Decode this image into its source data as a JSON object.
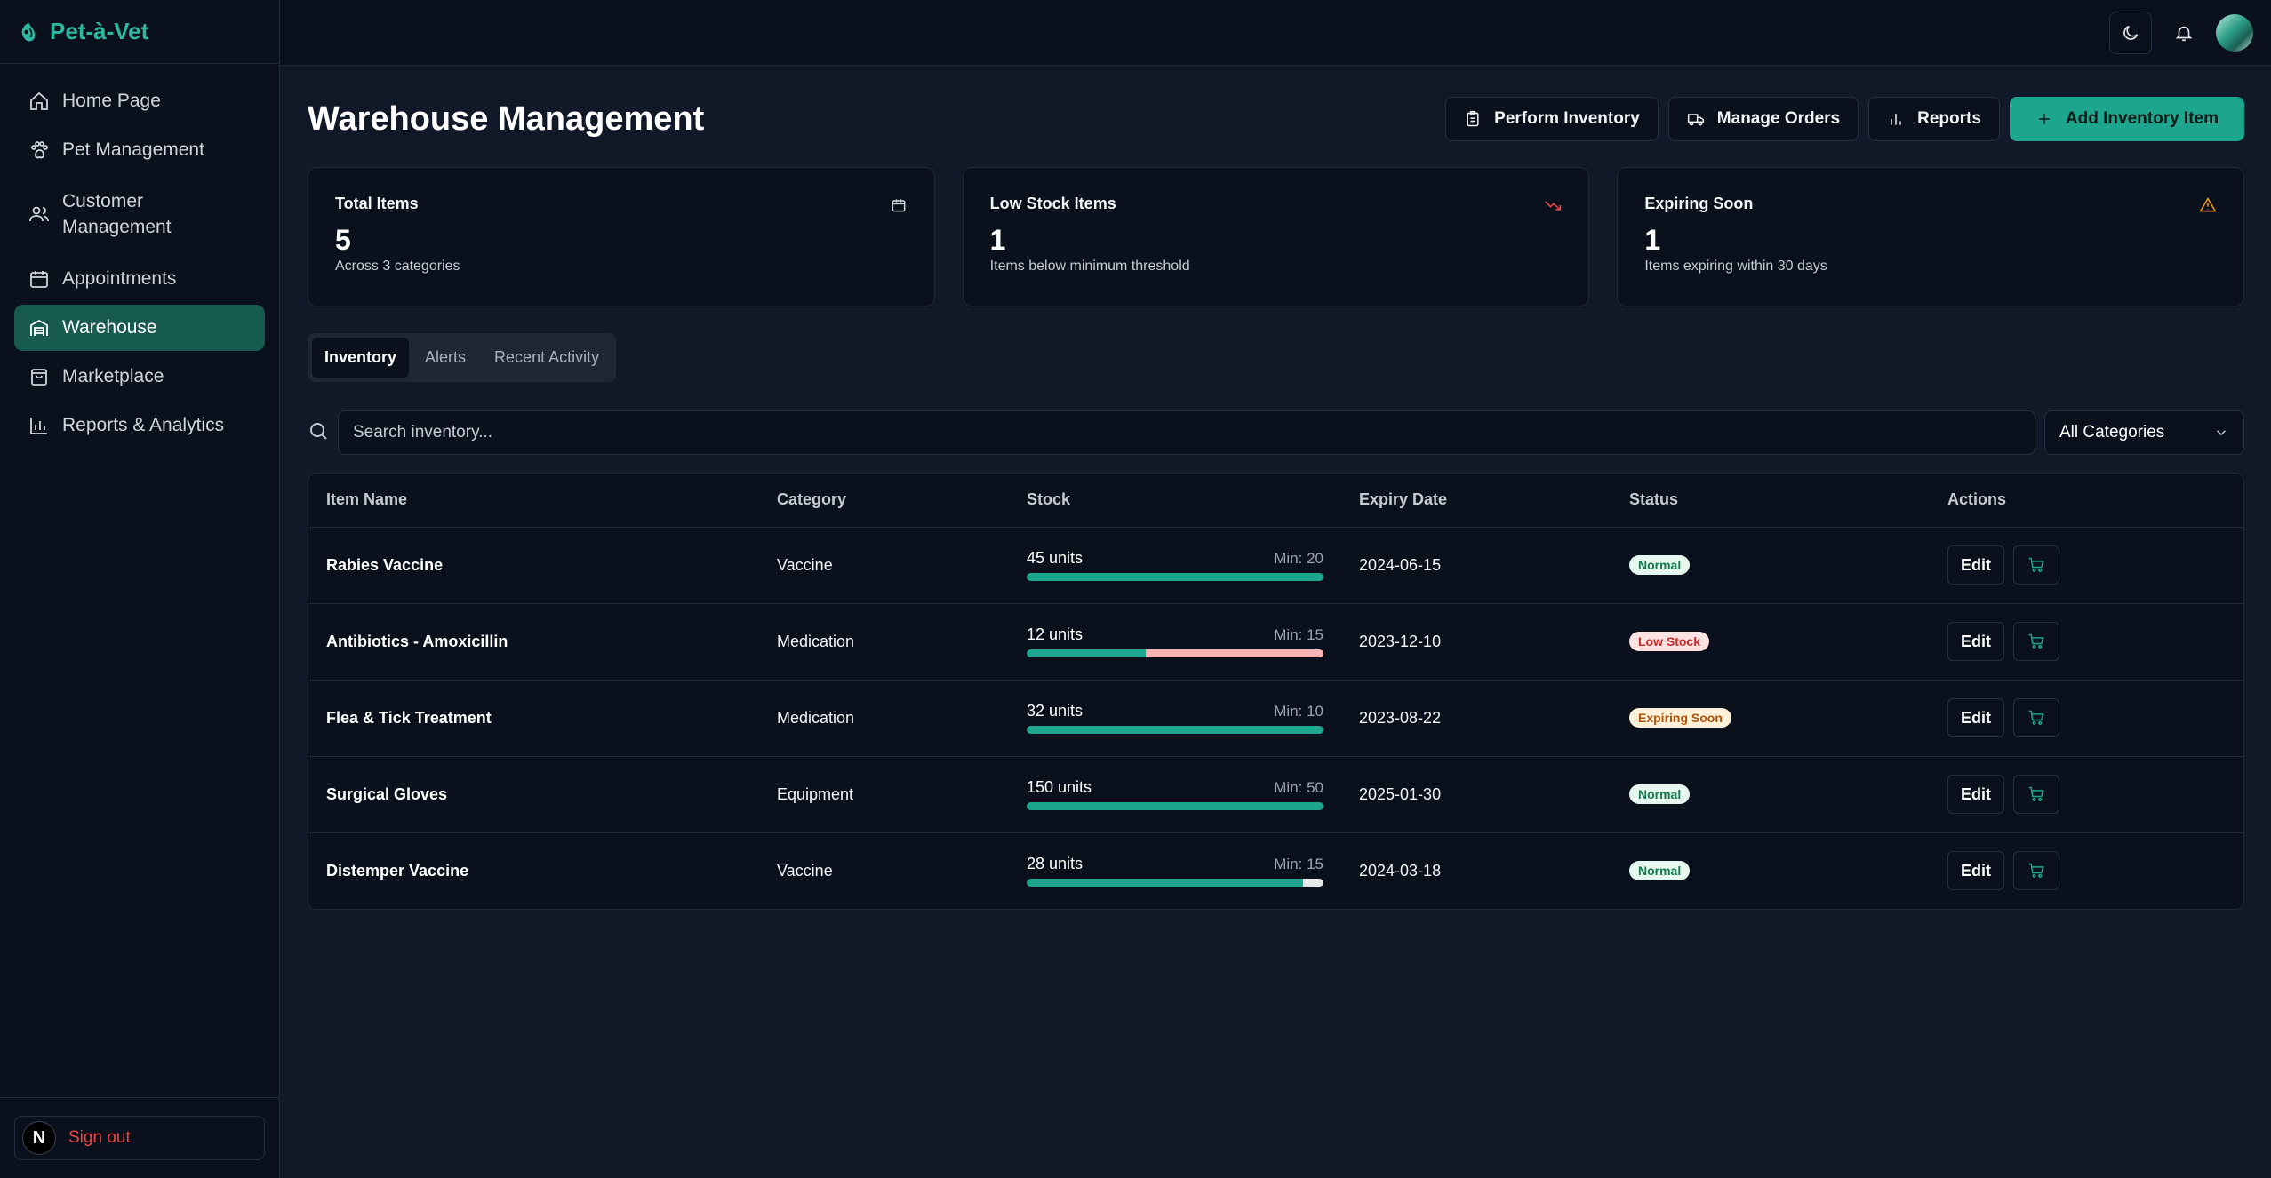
{
  "brand": {
    "name": "Pet-à-Vet",
    "color": "#2fb8a1"
  },
  "sidebar": {
    "items": [
      {
        "label": "Home Page",
        "icon": "home-icon",
        "active": false
      },
      {
        "label": "Pet Management",
        "icon": "paw-icon",
        "active": false
      },
      {
        "label": "Customer Management",
        "icon": "users-icon",
        "active": false
      },
      {
        "label": "Appointments",
        "icon": "calendar-icon",
        "active": false
      },
      {
        "label": "Warehouse",
        "icon": "warehouse-icon",
        "active": true
      },
      {
        "label": "Marketplace",
        "icon": "shopping-bag-icon",
        "active": false
      },
      {
        "label": "Reports & Analytics",
        "icon": "bar-chart-icon",
        "active": false
      }
    ],
    "footer": {
      "avatar_letter": "N",
      "signout_label": "Sign out"
    }
  },
  "page": {
    "title": "Warehouse Management",
    "actions": {
      "perform_inventory": "Perform Inventory",
      "manage_orders": "Manage Orders",
      "reports": "Reports",
      "add_item": "Add Inventory Item"
    }
  },
  "cards": [
    {
      "title": "Total Items",
      "value": "5",
      "sub": "Across 3 categories",
      "icon": "package-icon",
      "icon_color": "#d1d5db"
    },
    {
      "title": "Low Stock Items",
      "value": "1",
      "sub": "Items below minimum threshold",
      "icon": "trending-down-icon",
      "icon_color": "#ef4444"
    },
    {
      "title": "Expiring Soon",
      "value": "1",
      "sub": "Items expiring within 30 days",
      "icon": "warning-icon",
      "icon_color": "#f59e0b"
    }
  ],
  "tabs": [
    {
      "label": "Inventory",
      "active": true
    },
    {
      "label": "Alerts",
      "active": false
    },
    {
      "label": "Recent Activity",
      "active": false
    }
  ],
  "search": {
    "placeholder": "Search inventory...",
    "value": ""
  },
  "category_filter": {
    "selected": "All Categories"
  },
  "table": {
    "columns": [
      "Item Name",
      "Category",
      "Stock",
      "Expiry Date",
      "Status",
      "Actions"
    ],
    "rows": [
      {
        "name": "Rabies Vaccine",
        "category": "Vaccine",
        "units": "45 units",
        "min": "Min: 20",
        "fill": 1.0,
        "bar_color": "#1da58e",
        "rest_color": "#1da58e",
        "expiry": "2024-06-15",
        "status": "Normal",
        "status_type": "normal"
      },
      {
        "name": "Antibiotics - Amoxicillin",
        "category": "Medication",
        "units": "12 units",
        "min": "Min: 15",
        "fill": 0.4,
        "bar_color": "#1da58e",
        "rest_color": "#f8b4b4",
        "expiry": "2023-12-10",
        "status": "Low Stock",
        "status_type": "low"
      },
      {
        "name": "Flea & Tick Treatment",
        "category": "Medication",
        "units": "32 units",
        "min": "Min: 10",
        "fill": 1.0,
        "bar_color": "#1da58e",
        "rest_color": "#1da58e",
        "expiry": "2023-08-22",
        "status": "Expiring Soon",
        "status_type": "expiring"
      },
      {
        "name": "Surgical Gloves",
        "category": "Equipment",
        "units": "150 units",
        "min": "Min: 50",
        "fill": 1.0,
        "bar_color": "#1da58e",
        "rest_color": "#1da58e",
        "expiry": "2025-01-30",
        "status": "Normal",
        "status_type": "normal"
      },
      {
        "name": "Distemper Vaccine",
        "category": "Vaccine",
        "units": "28 units",
        "min": "Min: 15",
        "fill": 0.93,
        "bar_color": "#1da58e",
        "rest_color": "#e5e7eb",
        "expiry": "2024-03-18",
        "status": "Normal",
        "status_type": "normal"
      }
    ],
    "edit_label": "Edit"
  }
}
